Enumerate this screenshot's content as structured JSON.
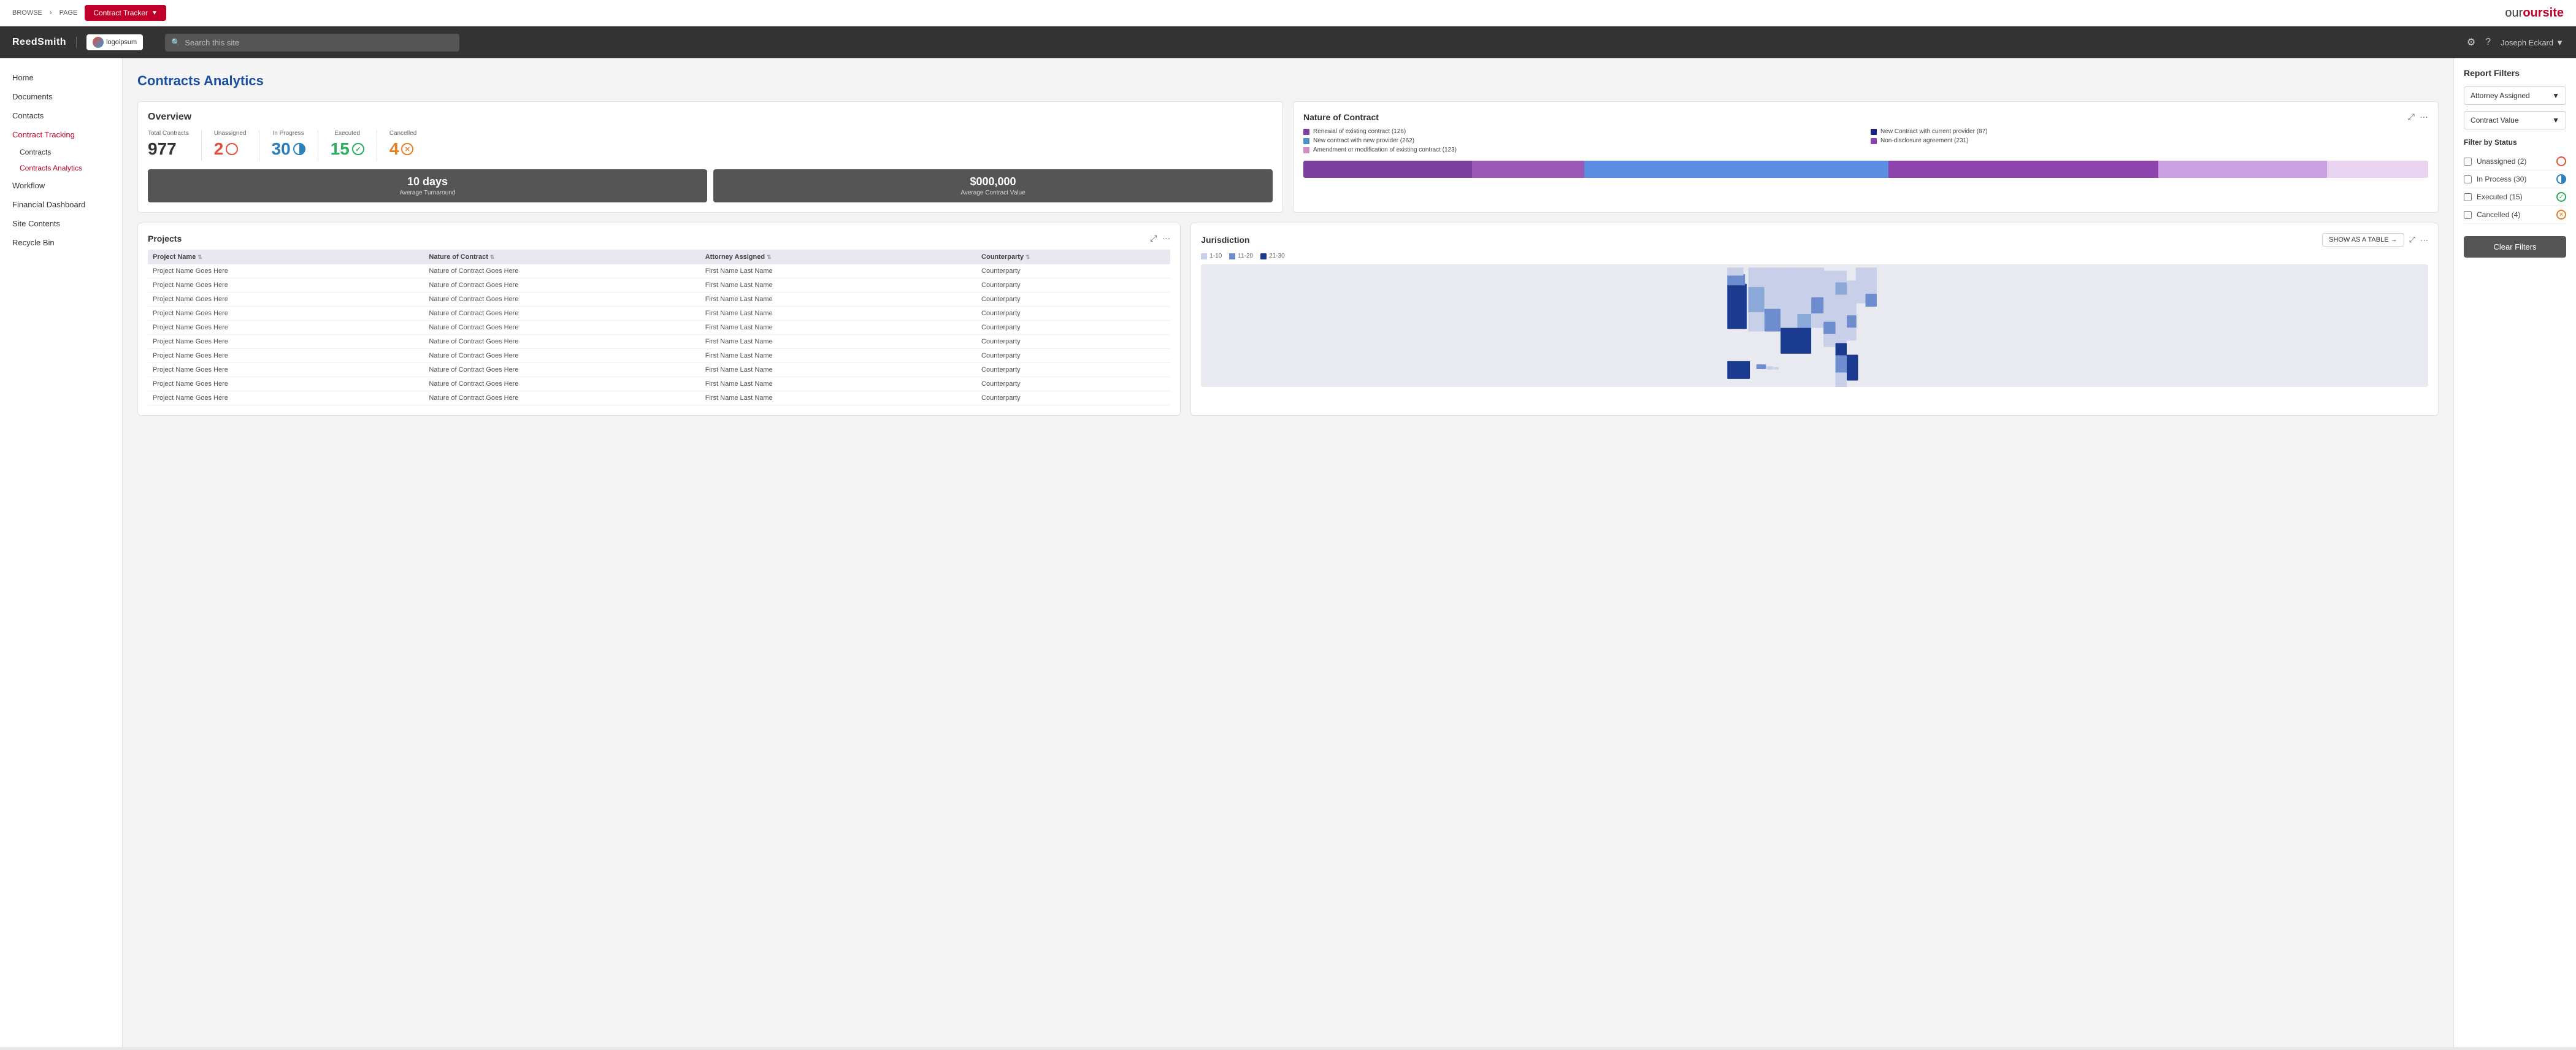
{
  "topbar": {
    "browse": "BROWSE",
    "page": "PAGE",
    "contract_tracker_btn": "Contract Tracker",
    "oursite": "oursite"
  },
  "navbar": {
    "brand": "ReedSmith",
    "logo_text": "logoipsum",
    "search_placeholder": "Search this site",
    "user": "Joseph Eckard"
  },
  "sidebar": {
    "items": [
      {
        "label": "Home"
      },
      {
        "label": "Documents"
      },
      {
        "label": "Contacts"
      },
      {
        "label": "Contract Tracking"
      },
      {
        "label": "Contracts"
      },
      {
        "label": "Contracts Analytics"
      },
      {
        "label": "Workflow"
      },
      {
        "label": "Financial Dashboard"
      },
      {
        "label": "Site Contents"
      },
      {
        "label": "Recycle Bin"
      }
    ]
  },
  "content": {
    "page_title": "Contracts Analytics",
    "overview": {
      "title": "Overview",
      "stats": {
        "total_label": "Total Contracts",
        "total_value": "977",
        "unassigned_label": "Unassigned",
        "unassigned_value": "2",
        "in_progress_label": "In Progress",
        "in_progress_value": "30",
        "executed_label": "Executed",
        "executed_value": "15",
        "cancelled_label": "Cancelled",
        "cancelled_value": "4"
      },
      "metrics": {
        "turnaround_value": "10 days",
        "turnaround_label": "Average Turnaround",
        "contract_value_value": "$000,000",
        "contract_value_label": "Average Contract Value"
      }
    },
    "nature_of_contract": {
      "title": "Nature of Contract",
      "legend": [
        {
          "label": "Renewal of existing contract (126)",
          "color": "#7b3fa0"
        },
        {
          "label": "New Contract with current provider (87)",
          "color": "#1a237e"
        },
        {
          "label": "New contract with new provider (262)",
          "color": "#4a90c4"
        },
        {
          "label": "Non-disclosure agreement (231)",
          "color": "#8e44ad"
        },
        {
          "label": "Amendment or modification of existing contract (123)",
          "color": "#d48bc8"
        }
      ],
      "bar_segments": [
        {
          "color": "#7b3fa0",
          "width": 15
        },
        {
          "color": "#9b4dca",
          "width": 12
        },
        {
          "color": "#5b8de0",
          "width": 27
        },
        {
          "color": "#8e44ad",
          "width": 24
        },
        {
          "color": "#c9a0e0",
          "width": 13
        },
        {
          "color": "#d4b8e8",
          "width": 9
        }
      ]
    },
    "projects": {
      "title": "Projects",
      "columns": [
        "Project Name",
        "Nature of Contract",
        "Attorney Assigned",
        "Counterparty"
      ],
      "rows": [
        {
          "project": "Project Name Goes Here",
          "nature": "Nature of Contract Goes Here",
          "attorney": "First Name Last Name",
          "counterparty": "Counterparty"
        },
        {
          "project": "Project Name Goes Here",
          "nature": "Nature of Contract Goes Here",
          "attorney": "First Name Last Name",
          "counterparty": "Counterparty"
        },
        {
          "project": "Project Name Goes Here",
          "nature": "Nature of Contract Goes Here",
          "attorney": "First Name Last Name",
          "counterparty": "Counterparty"
        },
        {
          "project": "Project Name Goes Here",
          "nature": "Nature of Contract Goes Here",
          "attorney": "First Name Last Name",
          "counterparty": "Counterparty"
        },
        {
          "project": "Project Name Goes Here",
          "nature": "Nature of Contract Goes Here",
          "attorney": "First Name Last Name",
          "counterparty": "Counterparty"
        },
        {
          "project": "Project Name Goes Here",
          "nature": "Nature of Contract Goes Here",
          "attorney": "First Name Last Name",
          "counterparty": "Counterparty"
        },
        {
          "project": "Project Name Goes Here",
          "nature": "Nature of Contract Goes Here",
          "attorney": "First Name Last Name",
          "counterparty": "Counterparty"
        },
        {
          "project": "Project Name Goes Here",
          "nature": "Nature of Contract Goes Here",
          "attorney": "First Name Last Name",
          "counterparty": "Counterparty"
        },
        {
          "project": "Project Name Goes Here",
          "nature": "Nature of Contract Goes Here",
          "attorney": "First Name Last Name",
          "counterparty": "Counterparty"
        },
        {
          "project": "Project Name Goes Here",
          "nature": "Nature of Contract Goes Here",
          "attorney": "First Name Last Name",
          "counterparty": "Counterparty"
        }
      ]
    },
    "jurisdiction": {
      "title": "Jurisdiction",
      "show_as_table_btn": "SHOW AS A TABLE →",
      "legend": [
        {
          "label": "1-10",
          "color": "#c8cfe8"
        },
        {
          "label": "11-20",
          "color": "#6e8dcf"
        },
        {
          "label": "21-30",
          "color": "#1a3a8f"
        }
      ]
    }
  },
  "right_panel": {
    "title": "Report Filters",
    "filters": [
      {
        "label": "Attorney Assigned"
      },
      {
        "label": "Contract Value"
      }
    ],
    "filter_by_status_title": "Filter by Status",
    "status_filters": [
      {
        "label": "Unassigned (2)",
        "badge_type": "red"
      },
      {
        "label": "In Process (30)",
        "badge_type": "blue"
      },
      {
        "label": "Executed (15)",
        "badge_type": "green"
      },
      {
        "label": "Cancelled (4)",
        "badge_type": "orange"
      }
    ],
    "clear_filters_label": "Clear Filters"
  }
}
